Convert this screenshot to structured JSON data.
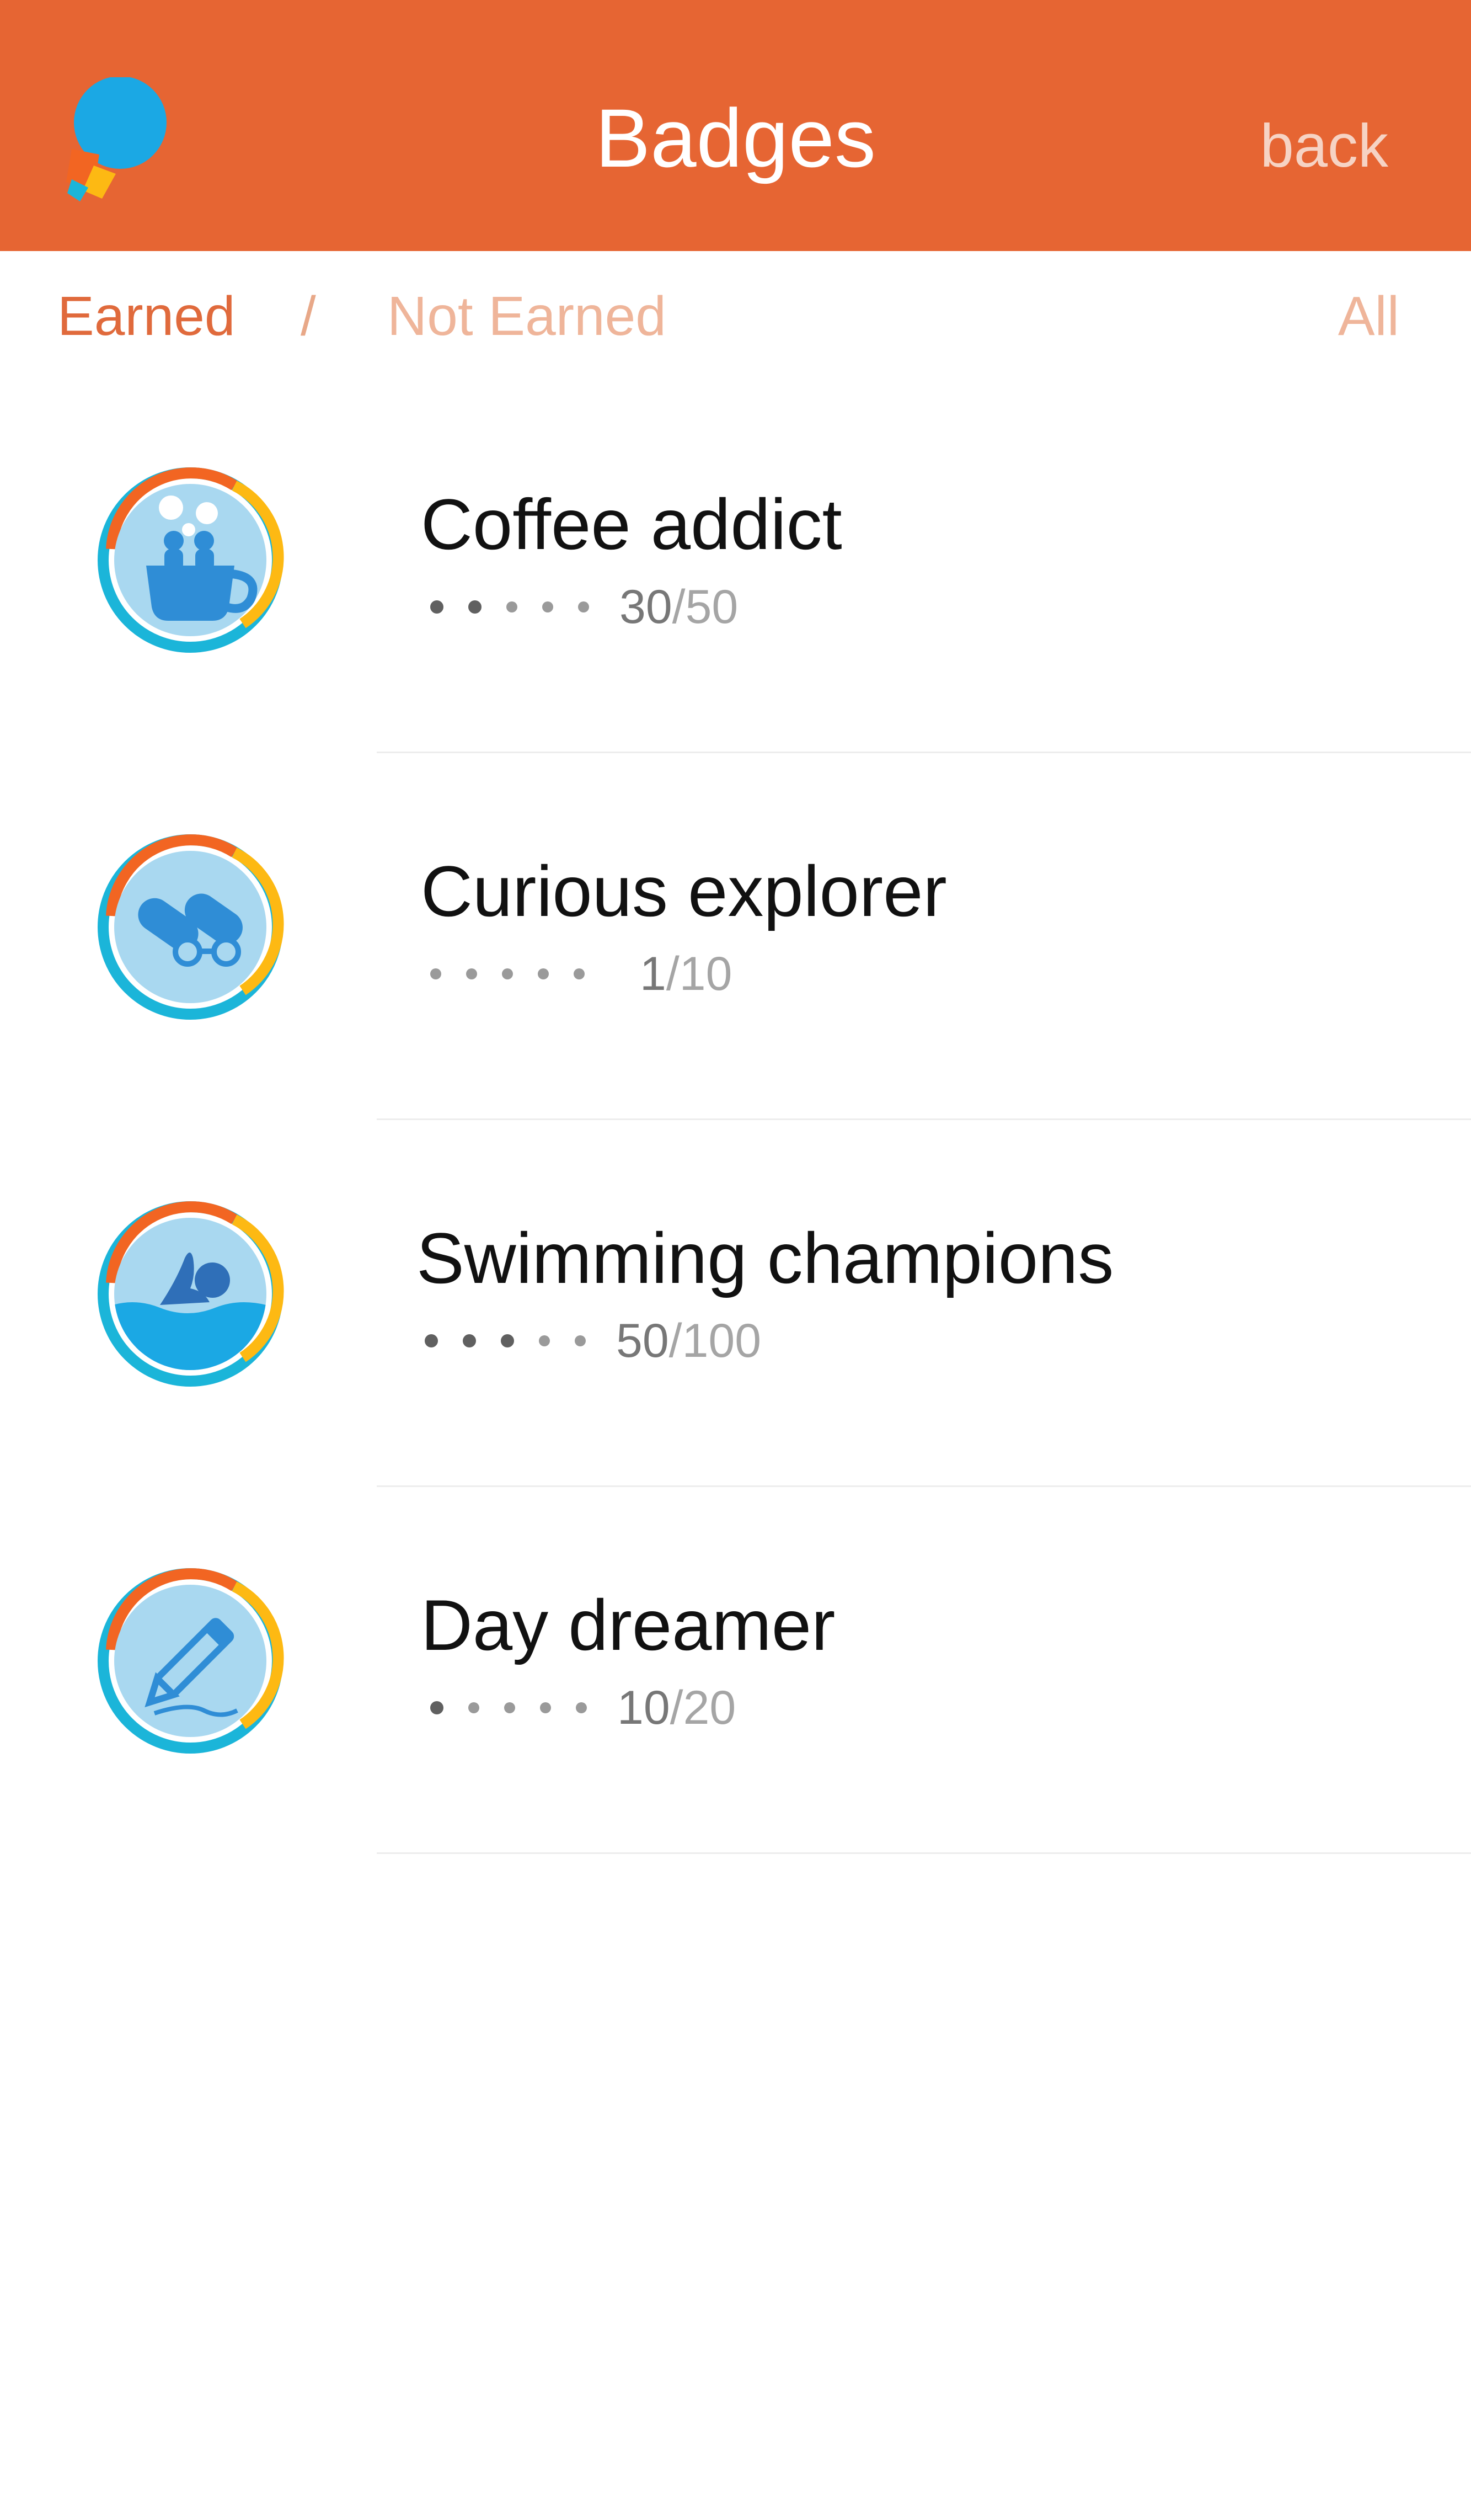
{
  "header": {
    "title": "Badges",
    "back_label": "back",
    "logo_icon": "speech-bubble-logo-icon",
    "background": "#E66533"
  },
  "filters": {
    "earned": "Earned",
    "separator": "/",
    "not_earned": "Not Earned",
    "all": "All"
  },
  "badges": [
    {
      "name": "Coffee addict",
      "current": "30",
      "total": "/50",
      "level": 2,
      "levels": 5,
      "icon": "coffee-cup-icon"
    },
    {
      "name": "Curious explorer",
      "current": "1",
      "total": "/10",
      "level": 0,
      "levels": 5,
      "icon": "binoculars-icon"
    },
    {
      "name": "Swimming champions",
      "current": "50",
      "total": "/100",
      "level": 3,
      "levels": 5,
      "icon": "swimmer-icon"
    },
    {
      "name": "Day dreamer",
      "current": "10",
      "total": "/20",
      "level": 1,
      "levels": 5,
      "icon": "pencil-icon"
    }
  ],
  "colors": {
    "accent": "#E66533",
    "ring_orange": "#F26522",
    "ring_yellow": "#FDB913",
    "ring_cyan": "#1BB5D9",
    "badge_fill": "#A9D8F0",
    "badge_icon": "#2F8DD6"
  }
}
